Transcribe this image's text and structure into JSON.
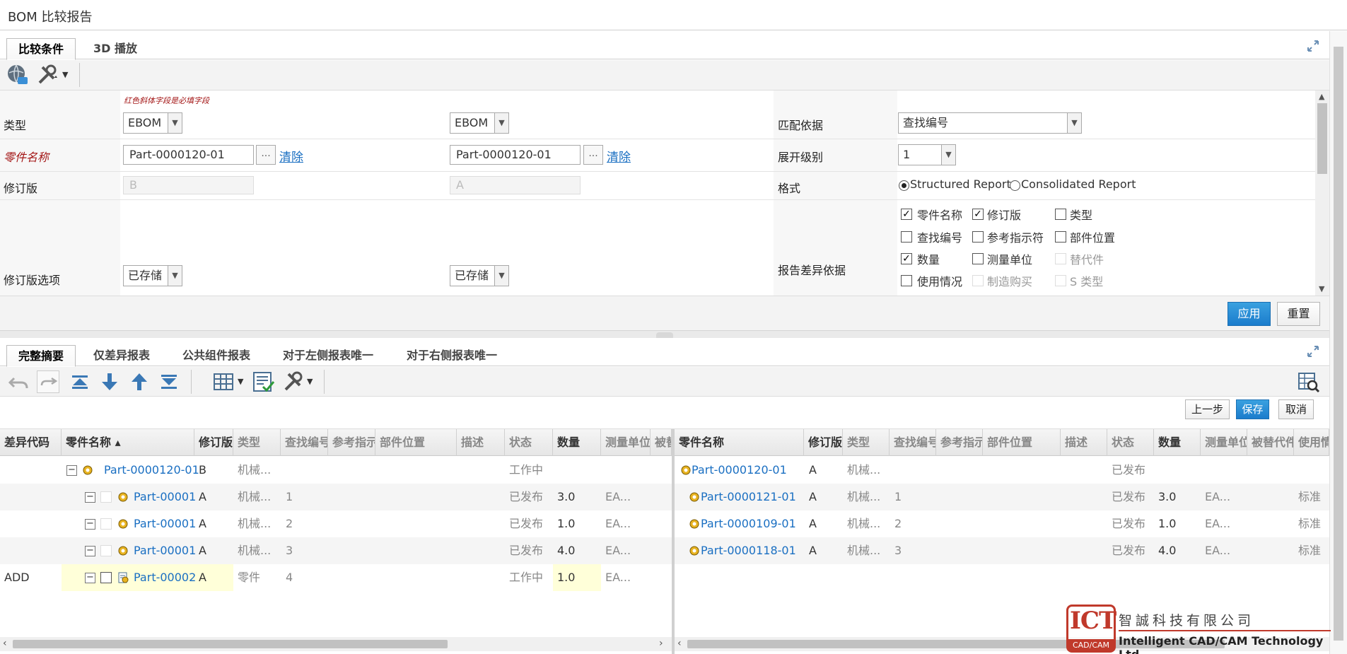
{
  "window": {
    "title": "BOM 比较报告"
  },
  "top_tabs": [
    {
      "label": "比较条件"
    },
    {
      "label": "3D 播放"
    }
  ],
  "form": {
    "required_note": "红色斜体字段是必填字段",
    "type": {
      "label": "类型",
      "left": "EBOM",
      "right": "EBOM"
    },
    "part_name": {
      "label": "零件名称",
      "left": "Part-0000120-01",
      "right": "Part-0000120-01",
      "browse": "...",
      "clear": "清除"
    },
    "revision": {
      "label": "修订版",
      "left": "B",
      "right": "A"
    },
    "revision_option": {
      "label": "修订版选项",
      "left": "已存储",
      "right": "已存储"
    },
    "match_by": {
      "label": "匹配依据",
      "value": "查找编号"
    },
    "expand_level": {
      "label": "展开级别",
      "value": "1"
    },
    "format": {
      "label": "格式",
      "options": [
        {
          "label": "Structured Report",
          "selected": true
        },
        {
          "label": "Consolidated Report",
          "selected": false
        }
      ]
    },
    "diff_basis": {
      "label": "报告差异依据",
      "options": [
        {
          "label": "零件名称",
          "checked": true,
          "enabled": true
        },
        {
          "label": "修订版",
          "checked": true,
          "enabled": true
        },
        {
          "label": "类型",
          "checked": false,
          "enabled": true
        },
        {
          "label": "查找编号",
          "checked": false,
          "enabled": true
        },
        {
          "label": "参考指示符",
          "checked": false,
          "enabled": true
        },
        {
          "label": "部件位置",
          "checked": false,
          "enabled": true
        },
        {
          "label": "数量",
          "checked": true,
          "enabled": true
        },
        {
          "label": "测量单位",
          "checked": false,
          "enabled": true
        },
        {
          "label": "替代件",
          "checked": false,
          "enabled": false
        },
        {
          "label": "使用情况",
          "checked": false,
          "enabled": true
        },
        {
          "label": "制造购买",
          "checked": false,
          "enabled": false
        },
        {
          "label": "S 类型",
          "checked": false,
          "enabled": false
        }
      ]
    },
    "apply": "应用",
    "reset": "重置"
  },
  "report_tabs": [
    {
      "label": "完整摘要"
    },
    {
      "label": "仅差异报表"
    },
    {
      "label": "公共组件报表"
    },
    {
      "label": "对于左侧报表唯一"
    },
    {
      "label": "对于右侧报表唯一"
    }
  ],
  "actions": {
    "prev": "上一步",
    "save": "保存",
    "cancel": "取消"
  },
  "left_grid": {
    "headers": [
      "差异代码",
      "零件名称 ▴",
      "修订版",
      "类型",
      "查找编号",
      "参考指示符",
      "部件位置",
      "描述",
      "状态",
      "数量",
      "测量单位",
      "被替"
    ],
    "rows": [
      {
        "code": "",
        "name": "Part-0000120-01",
        "rev": "B",
        "type": "机械...",
        "find": "",
        "state": "工作中",
        "qty": "",
        "unit": ""
      },
      {
        "code": "",
        "name": "Part-00001",
        "rev": "A",
        "type": "机械...",
        "find": "1",
        "state": "已发布",
        "qty": "3.0",
        "unit": "EA..."
      },
      {
        "code": "",
        "name": "Part-00001",
        "rev": "A",
        "type": "机械...",
        "find": "2",
        "state": "已发布",
        "qty": "1.0",
        "unit": "EA..."
      },
      {
        "code": "",
        "name": "Part-00001",
        "rev": "A",
        "type": "机械...",
        "find": "3",
        "state": "已发布",
        "qty": "4.0",
        "unit": "EA..."
      },
      {
        "code": "ADD",
        "name": "Part-00002",
        "rev": "A",
        "type": "零件",
        "find": "4",
        "state": "工作中",
        "qty": "1.0",
        "unit": "EA..."
      }
    ]
  },
  "right_grid": {
    "headers": [
      "零件名称",
      "修订版",
      "类型",
      "查找编号",
      "参考指示符",
      "部件位置",
      "描述",
      "状态",
      "数量",
      "测量单位",
      "被替代件",
      "使用情况"
    ],
    "rows": [
      {
        "name": "Part-0000120-01",
        "rev": "A",
        "type": "机械...",
        "find": "",
        "state": "已发布",
        "qty": "",
        "unit": "",
        "usage": ""
      },
      {
        "name": "Part-0000121-01",
        "rev": "A",
        "type": "机械...",
        "find": "1",
        "state": "已发布",
        "qty": "3.0",
        "unit": "EA...",
        "usage": "标准"
      },
      {
        "name": "Part-0000109-01",
        "rev": "A",
        "type": "机械...",
        "find": "2",
        "state": "已发布",
        "qty": "1.0",
        "unit": "EA...",
        "usage": "标准"
      },
      {
        "name": "Part-0000118-01",
        "rev": "A",
        "type": "机械...",
        "find": "3",
        "state": "已发布",
        "qty": "4.0",
        "unit": "EA...",
        "usage": "标准"
      }
    ]
  },
  "watermark": {
    "brand": "ICT",
    "tag": "CAD/CAM",
    "company_cn": "智誠科技有限公司",
    "company_en": "Intelligent CAD/CAM Technology Ltd."
  },
  "colors": {
    "accent": "#1b7ccc",
    "link": "#1a6fc2",
    "required": "#a31515",
    "brand_red": "#c0392b"
  }
}
